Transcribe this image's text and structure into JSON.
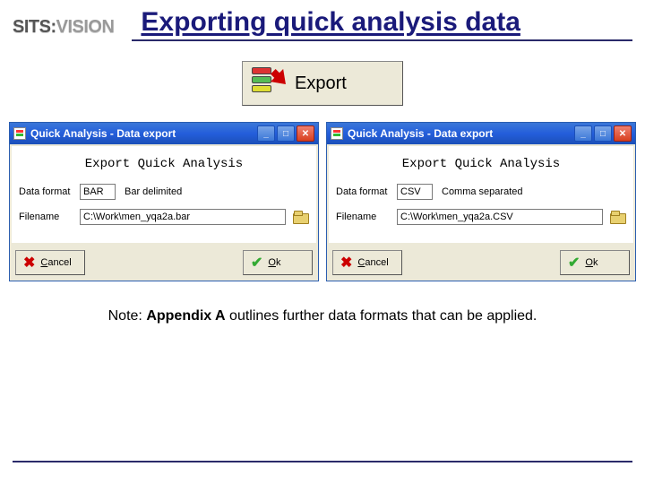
{
  "logo_text": "SITS:VISION",
  "title": "Exporting quick analysis data",
  "export_button": {
    "label": "Export"
  },
  "dialogs": [
    {
      "title": "Quick Analysis - Data export",
      "inner_title": "Export Quick Analysis",
      "data_format_label": "Data format",
      "format_code": "BAR",
      "format_desc": "Bar delimited",
      "filename_label": "Filename",
      "filename_value": "C:\\Work\\men_yqa2a.bar",
      "cancel": "Cancel",
      "ok": "Ok"
    },
    {
      "title": "Quick Analysis - Data export",
      "inner_title": "Export Quick Analysis",
      "data_format_label": "Data format",
      "format_code": "CSV",
      "format_desc": "Comma separated",
      "filename_label": "Filename",
      "filename_value": "C:\\Work\\men_yqa2a.CSV",
      "cancel": "Cancel",
      "ok": "Ok"
    }
  ],
  "note_prefix": "Note: ",
  "note_bold": "Appendix A",
  "note_suffix": " outlines further data formats that can be applied."
}
